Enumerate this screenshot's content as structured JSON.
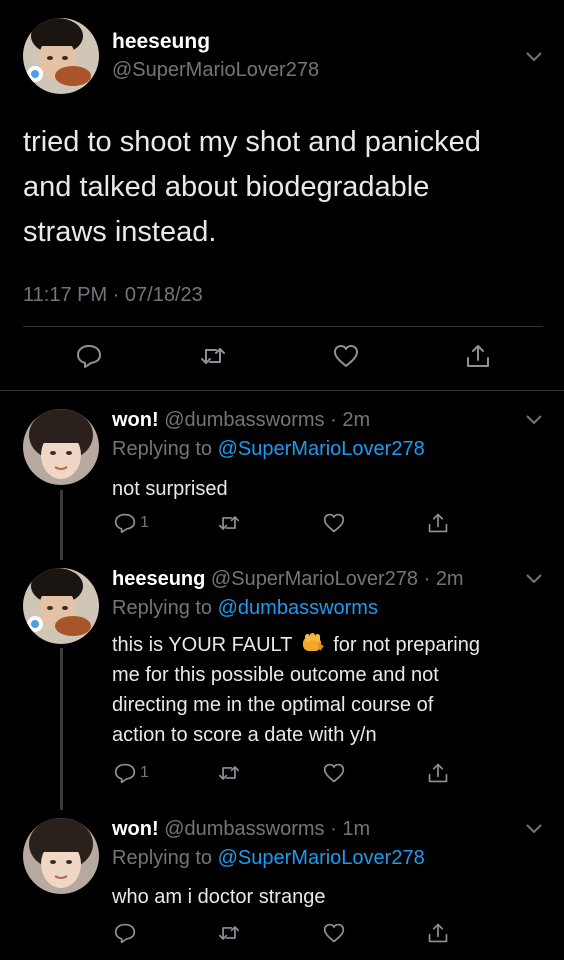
{
  "main_tweet": {
    "display_name": "heeseung",
    "handle": "@SuperMarioLover278",
    "text_lines": [
      "tried to shoot my shot and panicked",
      "and talked about biodegradable",
      "straws instead."
    ],
    "timestamp": "11:17 PM · 07/18/23"
  },
  "replies": [
    {
      "display_name": "won!",
      "handle": "@dumbassworms",
      "sep": "·",
      "time": "2m",
      "replying_label": "Replying to",
      "replying_to": "@SuperMarioLover278",
      "lines": [
        "not surprised"
      ],
      "reply_count": "1"
    },
    {
      "display_name": "heeseung",
      "handle": "@SuperMarioLover278",
      "sep": "·",
      "time": "2m",
      "replying_label": "Replying to",
      "replying_to": "@dumbassworms",
      "line1_a": "this is YOUR FAULT",
      "line1_b": "for not preparing",
      "lines": [
        "me for this possible outcome and not",
        "directing me in the optimal course of",
        "action to score a date with y/n"
      ],
      "emoji_icon": "oncoming-fist-emoji",
      "reply_count": "1"
    },
    {
      "display_name": "won!",
      "handle": "@dumbassworms",
      "sep": "·",
      "time": "1m",
      "replying_label": "Replying to",
      "replying_to": "@SuperMarioLover278",
      "lines": [
        "who am i doctor strange"
      ],
      "reply_count": ""
    }
  ],
  "icons": [
    "chevron-down-icon",
    "reply-icon",
    "retweet-icon",
    "like-icon",
    "share-icon"
  ],
  "colors": {
    "background": "#000000",
    "text": "#d9d9d9",
    "muted": "#71767b",
    "link": "#1d9bf0",
    "divider": "#2f3336"
  }
}
